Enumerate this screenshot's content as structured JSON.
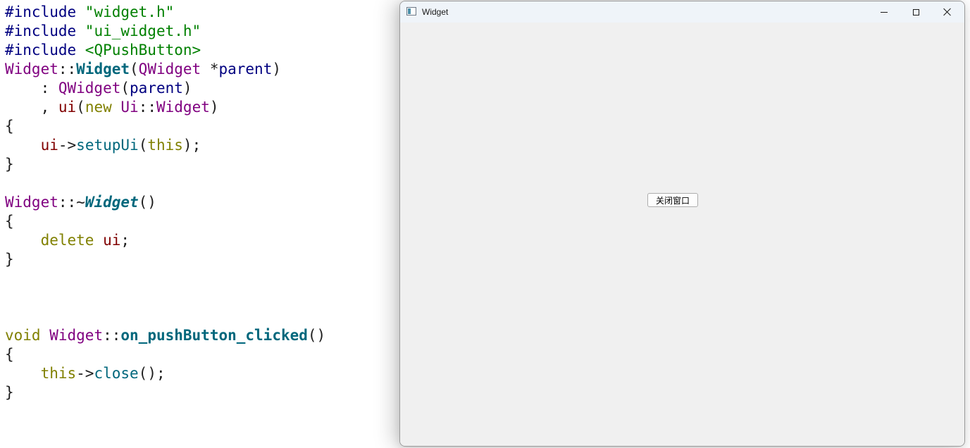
{
  "editor": {
    "lines": [
      [
        {
          "t": "#include ",
          "c": "pp"
        },
        {
          "t": "\"widget.h\"",
          "c": "str"
        }
      ],
      [
        {
          "t": "#include ",
          "c": "pp"
        },
        {
          "t": "\"ui_widget.h\"",
          "c": "str"
        }
      ],
      [
        {
          "t": "#include ",
          "c": "pp"
        },
        {
          "t": "<QPushButton>",
          "c": "inc"
        }
      ],
      [
        {
          "t": "Widget",
          "c": "cls"
        },
        {
          "t": "::",
          "c": "op"
        },
        {
          "t": "Widget",
          "c": "fnb"
        },
        {
          "t": "(",
          "c": "op"
        },
        {
          "t": "QWidget",
          "c": "cls"
        },
        {
          "t": " *",
          "c": "op"
        },
        {
          "t": "parent",
          "c": "param"
        },
        {
          "t": ")",
          "c": "op"
        }
      ],
      [
        {
          "t": "    : ",
          "c": "op"
        },
        {
          "t": "QWidget",
          "c": "cls"
        },
        {
          "t": "(",
          "c": "op"
        },
        {
          "t": "parent",
          "c": "param"
        },
        {
          "t": ")",
          "c": "op"
        }
      ],
      [
        {
          "t": "    , ",
          "c": "op"
        },
        {
          "t": "ui",
          "c": "mem"
        },
        {
          "t": "(",
          "c": "op"
        },
        {
          "t": "new",
          "c": "kw"
        },
        {
          "t": " ",
          "c": "op"
        },
        {
          "t": "Ui",
          "c": "cls"
        },
        {
          "t": "::",
          "c": "op"
        },
        {
          "t": "Widget",
          "c": "cls"
        },
        {
          "t": ")",
          "c": "op"
        }
      ],
      [
        {
          "t": "{",
          "c": "op"
        }
      ],
      [
        {
          "t": "    ",
          "c": "op"
        },
        {
          "t": "ui",
          "c": "mem"
        },
        {
          "t": "->",
          "c": "op"
        },
        {
          "t": "setupUi",
          "c": "fn"
        },
        {
          "t": "(",
          "c": "op"
        },
        {
          "t": "this",
          "c": "kw"
        },
        {
          "t": ");",
          "c": "op"
        }
      ],
      [
        {
          "t": "}",
          "c": "op"
        }
      ],
      [
        {
          "t": "",
          "c": "op"
        }
      ],
      [
        {
          "t": "Widget",
          "c": "cls"
        },
        {
          "t": "::~",
          "c": "op"
        },
        {
          "t": "Widget",
          "c": "fnbi"
        },
        {
          "t": "()",
          "c": "op"
        }
      ],
      [
        {
          "t": "{",
          "c": "op"
        }
      ],
      [
        {
          "t": "    ",
          "c": "op"
        },
        {
          "t": "delete",
          "c": "kw"
        },
        {
          "t": " ",
          "c": "op"
        },
        {
          "t": "ui",
          "c": "mem"
        },
        {
          "t": ";",
          "c": "op"
        }
      ],
      [
        {
          "t": "}",
          "c": "op"
        }
      ],
      [
        {
          "t": "",
          "c": "op"
        }
      ],
      [
        {
          "t": "",
          "c": "op"
        }
      ],
      [
        {
          "t": "",
          "c": "op"
        }
      ],
      [
        {
          "t": "void",
          "c": "kw"
        },
        {
          "t": " ",
          "c": "op"
        },
        {
          "t": "Widget",
          "c": "cls"
        },
        {
          "t": "::",
          "c": "op"
        },
        {
          "t": "on_pushButton_clicked",
          "c": "fnb"
        },
        {
          "t": "()",
          "c": "op"
        }
      ],
      [
        {
          "t": "{",
          "c": "op"
        }
      ],
      [
        {
          "t": "    ",
          "c": "op"
        },
        {
          "t": "this",
          "c": "kw"
        },
        {
          "t": "->",
          "c": "op"
        },
        {
          "t": "close",
          "c": "fn"
        },
        {
          "t": "();",
          "c": "op"
        }
      ],
      [
        {
          "t": "}",
          "c": "op"
        }
      ]
    ]
  },
  "window": {
    "title": "Widget",
    "icon": "app-window-icon",
    "controls": {
      "minimize_icon": "minimize-icon",
      "maximize_icon": "maximize-icon",
      "close_icon": "close-icon"
    },
    "button_label": "关闭窗口"
  },
  "colors": {
    "keyword": "#808000",
    "class": "#800080",
    "function": "#00677c",
    "preprocessor": "#000080",
    "string": "#008000",
    "member": "#800000",
    "window_bg": "#f0f0f0",
    "titlebar_bg": "#eff4f9"
  }
}
